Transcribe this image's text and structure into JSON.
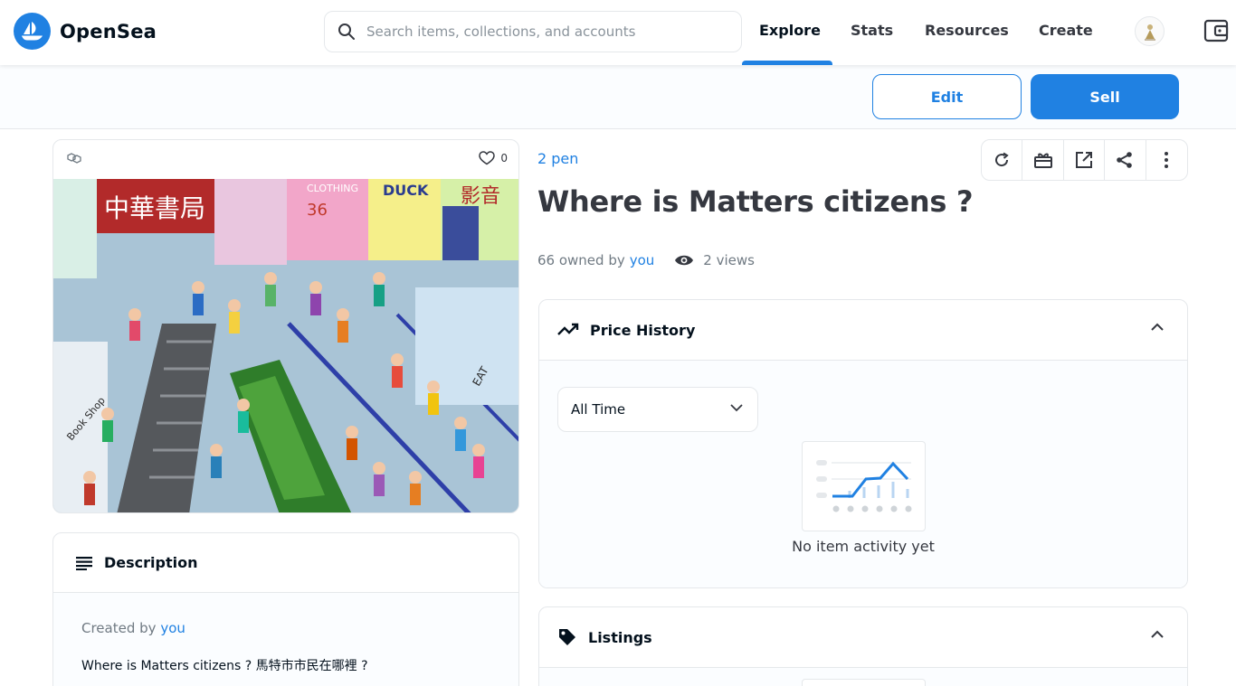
{
  "nav": {
    "brand": "OpenSea",
    "search_placeholder": "Search items, collections, and accounts",
    "links": [
      "Explore",
      "Stats",
      "Resources",
      "Create"
    ],
    "active_link": "Explore"
  },
  "owner_actions": {
    "edit_label": "Edit",
    "sell_label": "Sell"
  },
  "media": {
    "favorites_count": "0",
    "sign_texts": [
      "中華書局",
      "CLOTHING",
      "DUCK",
      "影音",
      "36",
      "Book Shop",
      "EAT"
    ]
  },
  "item": {
    "collection": "2 pen",
    "title": "Where is Matters citizens ?",
    "owned_count": "66 owned by",
    "owner": "you",
    "views": "2 views"
  },
  "description": {
    "heading": "Description",
    "created_prefix": "Created by",
    "creator": "you",
    "text": "Where is Matters citizens ? 馬特市市民在哪裡 ?"
  },
  "price_history": {
    "heading": "Price History",
    "range_selected": "All Time",
    "empty_message": "No item activity yet"
  },
  "listings": {
    "heading": "Listings"
  },
  "colors": {
    "accent": "#2081e2",
    "text": "#04111d",
    "muted": "#707a83",
    "border": "#e5e8eb"
  }
}
